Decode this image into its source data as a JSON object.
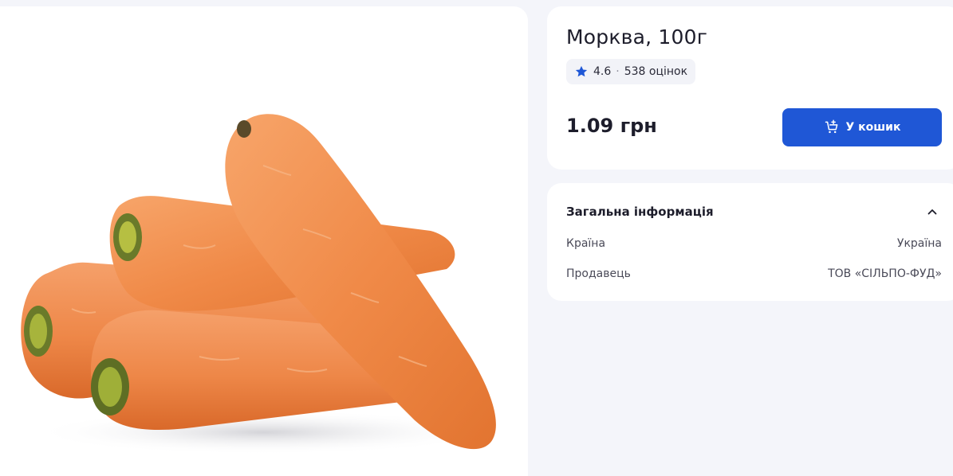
{
  "product": {
    "title": "Морква, 100г",
    "image_icon": "carrot-photo",
    "rating": {
      "icon": "star-icon",
      "value": "4.6",
      "separator": "·",
      "count_label": "538 оцінок",
      "star_color": "#1f57d6"
    },
    "price": "1.09 грн",
    "cart_button": {
      "label": "У кошик",
      "icon": "cart-add-icon",
      "color": "#1f57d6"
    }
  },
  "general_info": {
    "title": "Загальна інформація",
    "toggle_icon": "chevron-up-icon",
    "rows": [
      {
        "label": "Країна",
        "value": "Україна"
      },
      {
        "label": "Продавець",
        "value": "ТОВ «СІЛЬПО-ФУД»"
      }
    ]
  }
}
